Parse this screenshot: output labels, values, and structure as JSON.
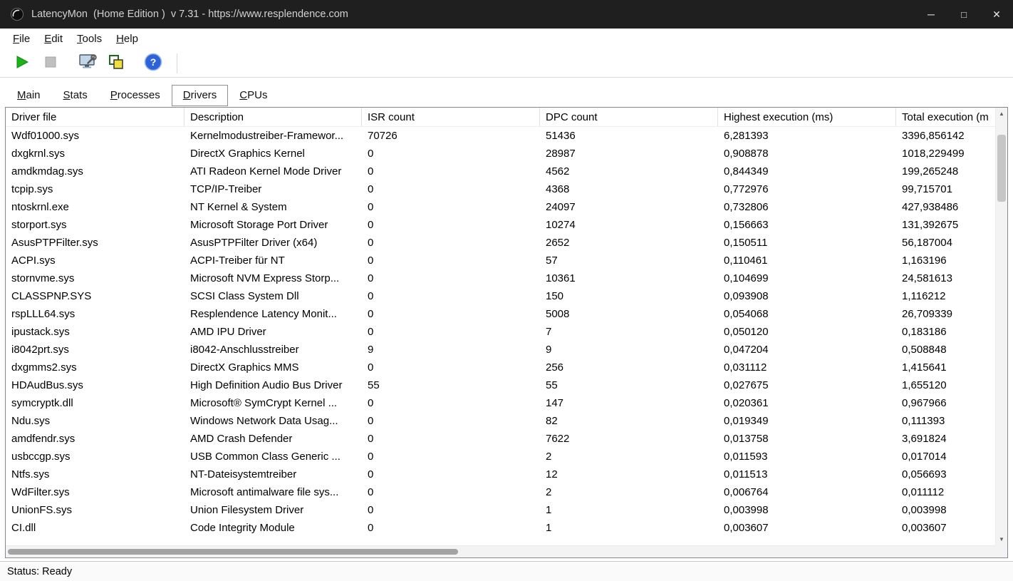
{
  "window": {
    "title": "LatencyMon  (Home Edition )  v 7.31 - https://www.resplendence.com",
    "controls": {
      "minimize": "─",
      "maximize": "□",
      "close": "✕"
    }
  },
  "menu": {
    "items": [
      {
        "label": "File"
      },
      {
        "label": "Edit"
      },
      {
        "label": "Tools"
      },
      {
        "label": "Help"
      }
    ]
  },
  "toolbar": {
    "buttons": [
      {
        "name": "start",
        "icon": "play-icon"
      },
      {
        "name": "stop",
        "icon": "stop-icon"
      },
      {
        "name": "options",
        "icon": "monitor-wrench-icon"
      },
      {
        "name": "report",
        "icon": "stacked-windows-icon"
      },
      {
        "name": "help",
        "icon": "help-icon"
      }
    ]
  },
  "tabs": [
    {
      "label": "Main",
      "selected": false
    },
    {
      "label": "Stats",
      "selected": false
    },
    {
      "label": "Processes",
      "selected": false
    },
    {
      "label": "Drivers",
      "selected": true
    },
    {
      "label": "CPUs",
      "selected": false
    }
  ],
  "table": {
    "columns": [
      "Driver file",
      "Description",
      "ISR count",
      "DPC count",
      "Highest execution (ms)",
      "Total execution (m"
    ],
    "rows": [
      [
        "Wdf01000.sys",
        "Kernelmodustreiber-Framewor...",
        "70726",
        "51436",
        "6,281393",
        "3396,856142"
      ],
      [
        "dxgkrnl.sys",
        "DirectX Graphics Kernel",
        "0",
        "28987",
        "0,908878",
        "1018,229499"
      ],
      [
        "amdkmdag.sys",
        "ATI Radeon Kernel Mode Driver",
        "0",
        "4562",
        "0,844349",
        "199,265248"
      ],
      [
        "tcpip.sys",
        "TCP/IP-Treiber",
        "0",
        "4368",
        "0,772976",
        "99,715701"
      ],
      [
        "ntoskrnl.exe",
        "NT Kernel & System",
        "0",
        "24097",
        "0,732806",
        "427,938486"
      ],
      [
        "storport.sys",
        "Microsoft Storage Port Driver",
        "0",
        "10274",
        "0,156663",
        "131,392675"
      ],
      [
        "AsusPTPFilter.sys",
        "AsusPTPFilter Driver (x64)",
        "0",
        "2652",
        "0,150511",
        "56,187004"
      ],
      [
        "ACPI.sys",
        "ACPI-Treiber für NT",
        "0",
        "57",
        "0,110461",
        "1,163196"
      ],
      [
        "stornvme.sys",
        "Microsoft NVM Express Storp...",
        "0",
        "10361",
        "0,104699",
        "24,581613"
      ],
      [
        "CLASSPNP.SYS",
        "SCSI Class System Dll",
        "0",
        "150",
        "0,093908",
        "1,116212"
      ],
      [
        "rspLLL64.sys",
        "Resplendence Latency Monit...",
        "0",
        "5008",
        "0,054068",
        "26,709339"
      ],
      [
        "ipustack.sys",
        "AMD IPU Driver",
        "0",
        "7",
        "0,050120",
        "0,183186"
      ],
      [
        "i8042prt.sys",
        "i8042-Anschlusstreiber",
        "9",
        "9",
        "0,047204",
        "0,508848"
      ],
      [
        "dxgmms2.sys",
        "DirectX Graphics MMS",
        "0",
        "256",
        "0,031112",
        "1,415641"
      ],
      [
        "HDAudBus.sys",
        "High Definition Audio Bus Driver",
        "55",
        "55",
        "0,027675",
        "1,655120"
      ],
      [
        "symcryptk.dll",
        "Microsoft® SymCrypt Kernel ...",
        "0",
        "147",
        "0,020361",
        "0,967966"
      ],
      [
        "Ndu.sys",
        "Windows Network Data Usag...",
        "0",
        "82",
        "0,019349",
        "0,111393"
      ],
      [
        "amdfendr.sys",
        "AMD Crash Defender",
        "0",
        "7622",
        "0,013758",
        "3,691824"
      ],
      [
        "usbccgp.sys",
        "USB Common Class Generic ...",
        "0",
        "2",
        "0,011593",
        "0,017014"
      ],
      [
        "Ntfs.sys",
        "NT-Dateisystemtreiber",
        "0",
        "12",
        "0,011513",
        "0,056693"
      ],
      [
        "WdFilter.sys",
        "Microsoft antimalware file sys...",
        "0",
        "2",
        "0,006764",
        "0,011112"
      ],
      [
        "UnionFS.sys",
        "Union Filesystem Driver",
        "0",
        "1",
        "0,003998",
        "0,003998"
      ],
      [
        "CI.dll",
        "Code Integrity Module",
        "0",
        "1",
        "0,003607",
        "0,003607"
      ]
    ]
  },
  "scrollbars": {
    "up_arrow": "▲",
    "down_arrow": "▼"
  },
  "status_bar": {
    "text": "Status: Ready"
  },
  "colors": {
    "titlebar_bg": "#1f1f1f",
    "play_green": "#1cb21c",
    "stop_gray": "#c0c0c0",
    "report_yellow": "#f0e03c",
    "help_blue": "#2e62d9",
    "border_gray": "#828790"
  }
}
